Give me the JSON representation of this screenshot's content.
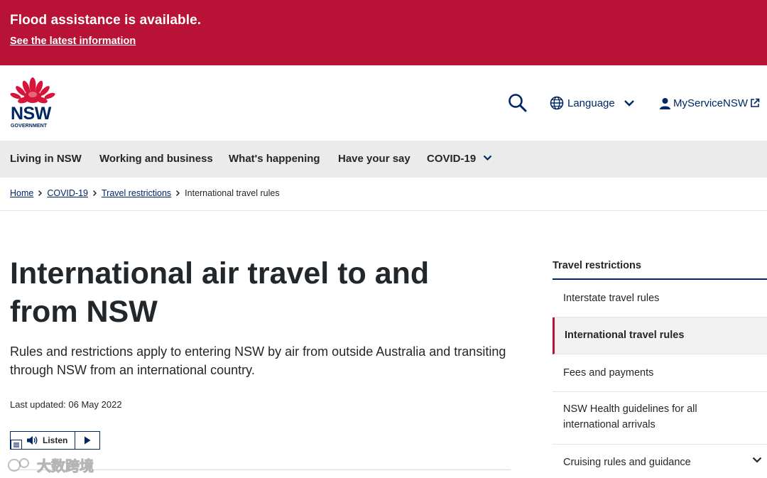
{
  "alert": {
    "title": "Flood assistance is available.",
    "link": "See the latest information",
    "color": "#b81237"
  },
  "header": {
    "logo": {
      "wordmark": "NSW",
      "subline": "GOVERNMENT"
    },
    "search_icon": "search-icon",
    "language_label": "Language",
    "myservice_label": "MyServiceNSW"
  },
  "main_nav": {
    "items": [
      "Living in NSW",
      "Working and business",
      "What's happening",
      "Have your say",
      "COVID-19"
    ]
  },
  "breadcrumb": {
    "links": [
      "Home",
      "COVID-19",
      "Travel restrictions"
    ],
    "current": "International travel rules"
  },
  "page": {
    "title": "International air travel to and from NSW",
    "intro": "Rules and restrictions apply to entering NSW by air from outside Australia and transiting through NSW from an international country.",
    "last_updated": "Last updated: 06 May 2022",
    "listen_label": "Listen"
  },
  "side_nav": {
    "heading": "Travel restrictions",
    "items": [
      {
        "label": "Interstate travel rules"
      },
      {
        "label": "International travel rules",
        "active": true
      },
      {
        "label": "Fees and payments"
      },
      {
        "label": "NSW Health guidelines for all international arrivals"
      },
      {
        "label": "Cruising rules and guidance",
        "expandable": true
      }
    ]
  },
  "watermark": {
    "text": "大数跨境"
  },
  "colors": {
    "brand_blue": "#002664",
    "brand_red": "#b81237",
    "nav_bg": "#ebebeb"
  }
}
